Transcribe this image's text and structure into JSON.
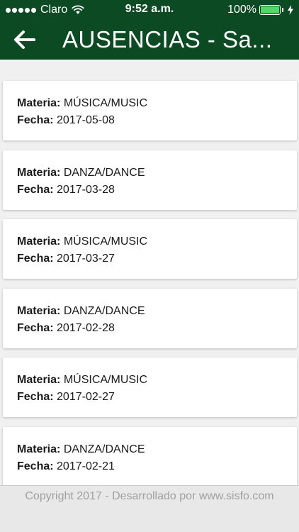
{
  "status_bar": {
    "carrier": "Claro",
    "time": "9:52 a.m.",
    "battery_percent": "100%",
    "battery_level": 1.0,
    "signal_icon": "signal-dots-icon",
    "wifi_icon": "wifi-icon",
    "charging_icon": "bolt-icon"
  },
  "header": {
    "title": "AUSENCIAS - Sa...",
    "back_icon": "arrow-left-icon",
    "background": "#0b4a22"
  },
  "list": {
    "materia_label": "Materia:",
    "fecha_label": "Fecha:",
    "items": [
      {
        "materia": "MÚSICA/MUSIC",
        "fecha": "2017-05-08"
      },
      {
        "materia": "DANZA/DANCE",
        "fecha": "2017-03-28"
      },
      {
        "materia": "MÚSICA/MUSIC",
        "fecha": "2017-03-27"
      },
      {
        "materia": "DANZA/DANCE",
        "fecha": "2017-02-28"
      },
      {
        "materia": "MÚSICA/MUSIC",
        "fecha": "2017-02-27"
      },
      {
        "materia": "DANZA/DANCE",
        "fecha": "2017-02-21"
      }
    ]
  },
  "footer": {
    "text": "Copyright 2017 - Desarrollado por www.sisfo.com"
  }
}
